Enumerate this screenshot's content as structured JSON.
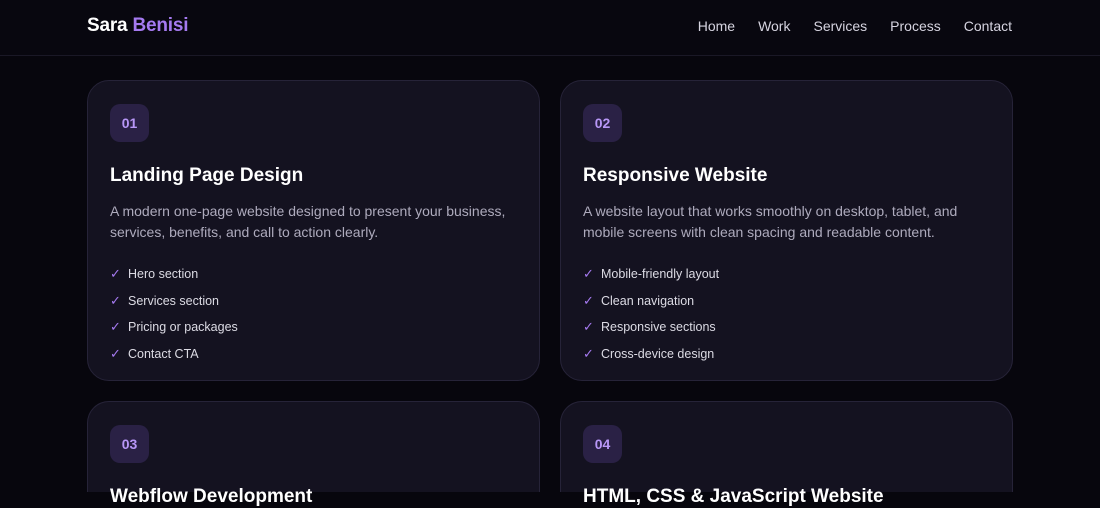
{
  "brand": {
    "first": "Sara",
    "last": "Benisi"
  },
  "nav": [
    {
      "label": "Home"
    },
    {
      "label": "Work"
    },
    {
      "label": "Services"
    },
    {
      "label": "Process"
    },
    {
      "label": "Contact"
    }
  ],
  "check_glyph": "✓",
  "cards": [
    {
      "number": "01",
      "title": "Landing Page Design",
      "description": "A modern one-page website designed to present your business, services, benefits, and call to action clearly.",
      "features": [
        "Hero section",
        "Services section",
        "Pricing or packages",
        "Contact CTA"
      ]
    },
    {
      "number": "02",
      "title": "Responsive Website",
      "description": "A website layout that works smoothly on desktop, tablet, and mobile screens with clean spacing and readable content.",
      "features": [
        "Mobile-friendly layout",
        "Clean navigation",
        "Responsive sections",
        "Cross-device design"
      ]
    },
    {
      "number": "03",
      "title": "Webflow Development"
    },
    {
      "number": "04",
      "title": "HTML, CSS & JavaScript Website"
    }
  ],
  "colors": {
    "accent": "#a57af0",
    "background": "#07060d",
    "card": "#141220"
  }
}
